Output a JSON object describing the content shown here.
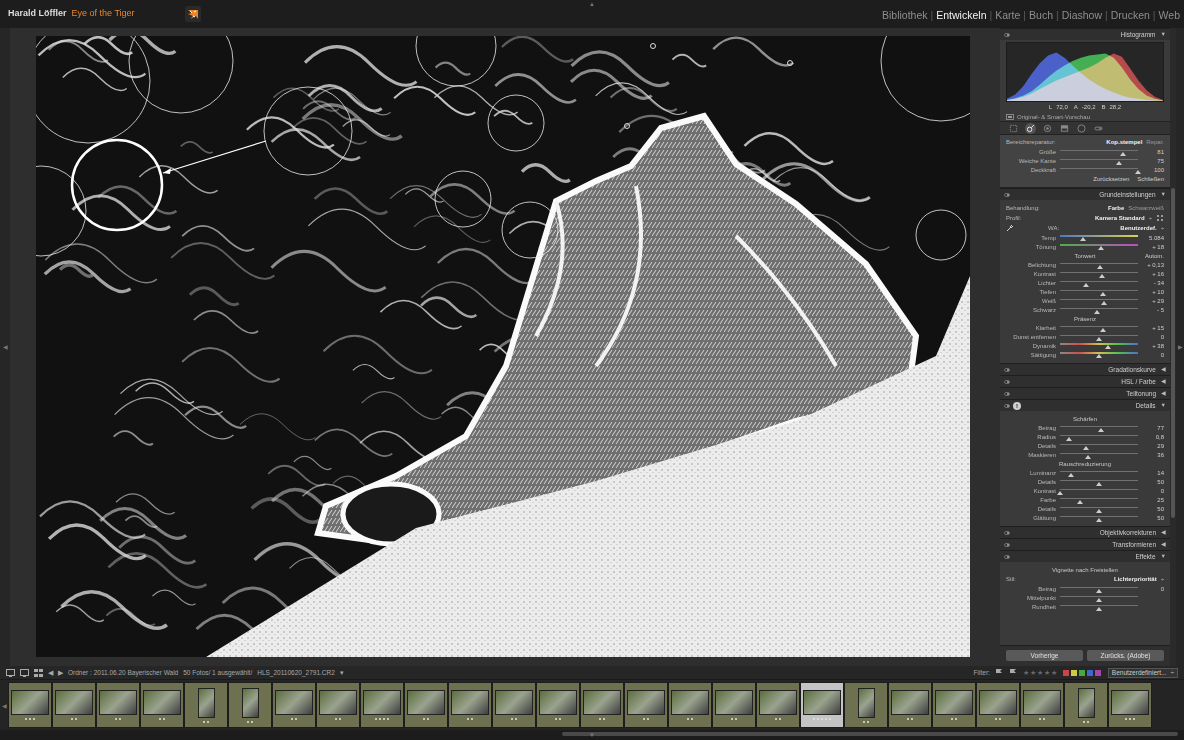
{
  "identity": {
    "name": "Harald Löffler",
    "tagline": "Eye of the Tiger"
  },
  "modules": [
    {
      "label": "Bibliothek",
      "selected": false
    },
    {
      "label": "Entwickeln",
      "selected": true
    },
    {
      "label": "Karte",
      "selected": false
    },
    {
      "label": "Buch",
      "selected": false
    },
    {
      "label": "Diashow",
      "selected": false
    },
    {
      "label": "Drucken",
      "selected": false
    },
    {
      "label": "Web",
      "selected": false
    }
  ],
  "module_separator": "|",
  "panel_toggles": {
    "top": "▲",
    "bottom": "▼",
    "left": "◀",
    "right": "▶",
    "filmstrip_left": "◀"
  },
  "histogram": {
    "title": "Histogramm",
    "arrow": "▼",
    "series": [
      {
        "color": "#e23a3a",
        "values": [
          2,
          4,
          8,
          14,
          22,
          30,
          38,
          44,
          50,
          56,
          62,
          70,
          80,
          88,
          82,
          60,
          38,
          20,
          8,
          2
        ]
      },
      {
        "color": "#2fd64a",
        "values": [
          2,
          5,
          10,
          18,
          30,
          44,
          56,
          66,
          74,
          80,
          84,
          86,
          88,
          80,
          62,
          40,
          22,
          10,
          4,
          1
        ]
      },
      {
        "color": "#3a5cff",
        "values": [
          4,
          12,
          28,
          50,
          70,
          84,
          90,
          80,
          66,
          52,
          40,
          30,
          22,
          16,
          10,
          6,
          4,
          2,
          1,
          0
        ]
      }
    ],
    "readout": [
      {
        "label": "L",
        "value": "72,0"
      },
      {
        "label": "A",
        "value": "-20,2"
      },
      {
        "label": "B",
        "value": "28,2"
      }
    ],
    "preview": "Original- & Smart-Vorschau"
  },
  "tools": [
    {
      "selected": false
    },
    {
      "selected": true
    },
    {
      "selected": false
    },
    {
      "selected": false
    },
    {
      "selected": false
    },
    {
      "selected": false
    }
  ],
  "spot": {
    "label": "Bereichsreparatur:",
    "modes": [
      {
        "label": "Kop.stempel",
        "selected": true
      },
      {
        "label": "Repar.",
        "selected": false
      }
    ],
    "sliders": [
      {
        "label": "Größe",
        "value": "81",
        "level": 0.81
      },
      {
        "label": "Weiche Kante",
        "value": "75",
        "level": 0.75
      },
      {
        "label": "Deckkraft",
        "value": "100",
        "level": 1
      }
    ],
    "buttons": [
      "Zurücksetzen",
      "Schließen"
    ]
  },
  "panels": [
    {
      "title": "Grundeinstellungen",
      "arrow": "▼",
      "expanded": true,
      "rows": [
        {
          "kind": "toggle",
          "label": "Behandlung:",
          "options": [
            {
              "label": "Farbe",
              "selected": true
            },
            {
              "label": "Schwarzweiß",
              "selected": false
            }
          ]
        },
        {
          "kind": "profile",
          "label": "Profil:",
          "value": "Kamera Standard",
          "caret": "÷"
        },
        {
          "kind": "wb",
          "label": "WA:",
          "value": "Benutzerdef.",
          "caret": "÷"
        },
        {
          "kind": "slider-temp",
          "label": "Temp",
          "value": "5.084",
          "level": 0.3
        },
        {
          "kind": "slider-tint",
          "label": "Tönung",
          "value": "+ 18",
          "level": 0.53
        },
        {
          "kind": "heading",
          "label": "Tonwert",
          "action": "Autom."
        },
        {
          "kind": "slider",
          "label": "Belichtung",
          "value": "+ 0,13",
          "level": 0.51
        },
        {
          "kind": "slider",
          "label": "Kontrast",
          "value": "+ 16",
          "level": 0.54
        },
        {
          "kind": "slider",
          "label": "Lichter",
          "value": "- 34",
          "level": 0.33
        },
        {
          "kind": "slider",
          "label": "Tiefen",
          "value": "+ 10",
          "level": 0.55
        },
        {
          "kind": "slider",
          "label": "Weiß",
          "value": "+ 29",
          "level": 0.57
        },
        {
          "kind": "slider",
          "label": "Schwarz",
          "value": "- 5",
          "level": 0.48
        },
        {
          "kind": "heading",
          "label": "Präsenz"
        },
        {
          "kind": "slider",
          "label": "Klarheit",
          "value": "+ 15",
          "level": 0.55
        },
        {
          "kind": "slider",
          "label": "Dunst entfernen",
          "value": "0",
          "level": 0.5
        },
        {
          "kind": "slider-sat",
          "label": "Dynamik",
          "value": "+ 38",
          "level": 0.62
        },
        {
          "kind": "slider-sat",
          "label": "Sättigung",
          "value": "0",
          "level": 0.5
        }
      ]
    },
    {
      "title": "Gradationskurve",
      "arrow": "◀",
      "expanded": false,
      "rows": []
    },
    {
      "title": "HSL / Farbe",
      "arrow": "◀",
      "expanded": false,
      "rows": []
    },
    {
      "title": "Teiltonung",
      "arrow": "◀",
      "expanded": false,
      "rows": []
    },
    {
      "title": "Details",
      "arrow": "▼",
      "expanded": true,
      "badge": "!",
      "rows": [
        {
          "kind": "heading",
          "label": "Schärfen"
        },
        {
          "kind": "slider",
          "label": "Betrag",
          "value": "77",
          "level": 0.53
        },
        {
          "kind": "slider",
          "label": "Radius",
          "value": "0,8",
          "level": 0.12
        },
        {
          "kind": "slider",
          "label": "Details",
          "value": "29",
          "level": 0.33
        },
        {
          "kind": "slider",
          "label": "Maskieren",
          "value": "36",
          "level": 0.36
        },
        {
          "kind": "heading",
          "label": "Rauschreduzierung"
        },
        {
          "kind": "slider",
          "label": "Luminanz",
          "value": "14",
          "level": 0.14
        },
        {
          "kind": "slider",
          "label": "Details",
          "value": "50",
          "level": 0.5
        },
        {
          "kind": "slider",
          "label": "Kontrast",
          "value": "0",
          "level": 0
        },
        {
          "kind": "slider",
          "label": "Farbe",
          "value": "25",
          "level": 0.25
        },
        {
          "kind": "slider",
          "label": "Details",
          "value": "50",
          "level": 0.5
        },
        {
          "kind": "slider",
          "label": "Glättung",
          "value": "50",
          "level": 0.5
        }
      ]
    },
    {
      "title": "Objektivkorrekturen",
      "arrow": "◀",
      "expanded": false,
      "rows": []
    },
    {
      "title": "Transformieren",
      "arrow": "◀",
      "expanded": false,
      "rows": []
    },
    {
      "title": "Effekte",
      "arrow": "▼",
      "expanded": true,
      "rows": [
        {
          "kind": "heading",
          "label": "Vignette nach Freistellen"
        },
        {
          "kind": "select",
          "label": "Stil:",
          "value": "Lichterpriorität",
          "caret": "÷"
        },
        {
          "kind": "slider",
          "label": "Betrag",
          "value": "0",
          "level": 0.5
        },
        {
          "kind": "slider",
          "label": "Mittelpunkt",
          "level": 0.5
        },
        {
          "kind": "slider",
          "label": "Rundheit",
          "level": 0.5
        }
      ]
    }
  ],
  "panel_buttons": [
    "Vorherige",
    "Zurücks. (Adobe)"
  ],
  "filmstrip": {
    "nav": [
      "◀",
      "▶"
    ],
    "folder": "Ordner : 2011.06.20 Bayerischer Wald",
    "count": "50 Fotos/ 1 ausgewählt/",
    "file": "HLS_20110620_2791.CR2",
    "file_caret": "▾",
    "filter_label": "Filter:",
    "filter_stars": "★★★★★",
    "filter_preset": "Benutzerdefiniert...",
    "filter_caret": "÷",
    "thumbnails": [
      {
        "kind": "landscape",
        "stars": 3,
        "selected": false
      },
      {
        "kind": "landscape",
        "stars": 2,
        "selected": false
      },
      {
        "kind": "landscape",
        "stars": 2,
        "selected": false
      },
      {
        "kind": "landscape",
        "stars": 2,
        "selected": false
      },
      {
        "kind": "portrait",
        "stars": 2,
        "selected": false
      },
      {
        "kind": "portrait",
        "stars": 2,
        "selected": false
      },
      {
        "kind": "landscape",
        "stars": 2,
        "selected": false
      },
      {
        "kind": "landscape",
        "stars": 2,
        "selected": false
      },
      {
        "kind": "landscape",
        "stars": 4,
        "selected": false
      },
      {
        "kind": "landscape",
        "stars": 2,
        "selected": false
      },
      {
        "kind": "landscape",
        "stars": 2,
        "selected": false
      },
      {
        "kind": "landscape",
        "stars": 2,
        "selected": false
      },
      {
        "kind": "landscape",
        "stars": 2,
        "selected": false
      },
      {
        "kind": "landscape",
        "stars": 2,
        "selected": false
      },
      {
        "kind": "landscape",
        "stars": 2,
        "selected": false
      },
      {
        "kind": "landscape",
        "stars": 2,
        "selected": false
      },
      {
        "kind": "landscape",
        "stars": 2,
        "selected": false
      },
      {
        "kind": "landscape",
        "stars": 2,
        "selected": false
      },
      {
        "kind": "landscape",
        "stars": 5,
        "selected": true
      },
      {
        "kind": "portrait",
        "stars": 2,
        "selected": false
      },
      {
        "kind": "landscape",
        "stars": 2,
        "selected": false
      },
      {
        "kind": "landscape",
        "stars": 2,
        "selected": false
      },
      {
        "kind": "landscape",
        "stars": 2,
        "selected": false
      },
      {
        "kind": "landscape",
        "stars": 2,
        "selected": false
      },
      {
        "kind": "portrait",
        "stars": 2,
        "selected": false
      },
      {
        "kind": "landscape",
        "stars": 3,
        "selected": false
      }
    ]
  }
}
